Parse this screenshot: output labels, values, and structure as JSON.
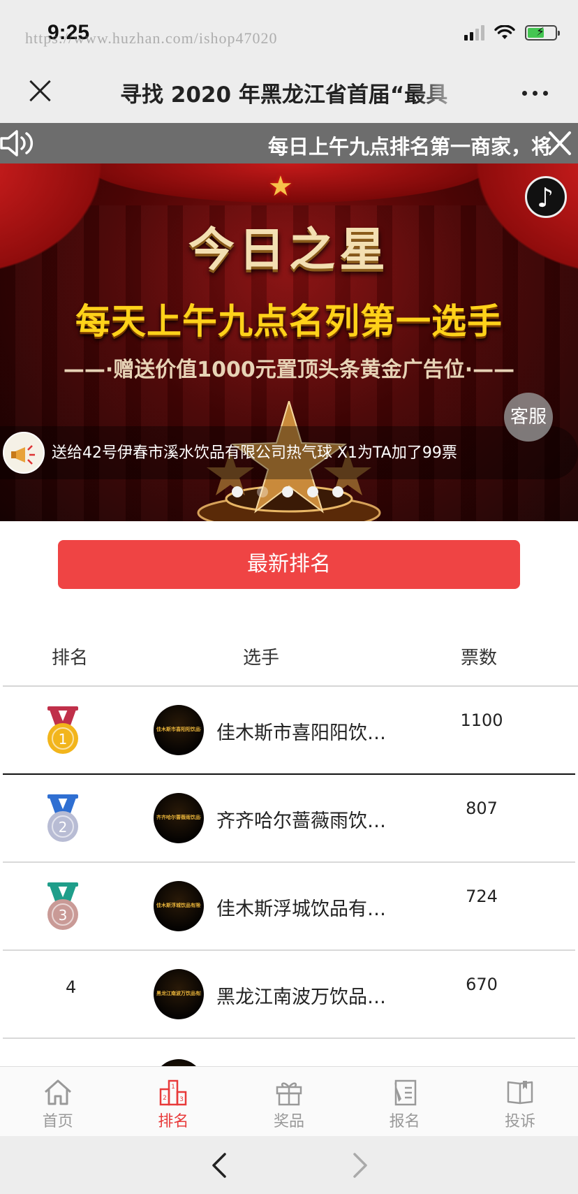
{
  "status_bar": {
    "time": "9:25",
    "watermark": "https://www.huzhan.com/ishop47020",
    "battery_level": 0.6
  },
  "nav": {
    "title": "寻找 2020 年黑龙江省首届“最具"
  },
  "marquee": {
    "text": "每日上午九点排名第一商家，将"
  },
  "banner": {
    "headline": "今日之星",
    "subline": "每天上午九点名列第一选手",
    "promo": "——·赠送价值1000元置顶头条黄金广告位·——",
    "gift_message": "送给42号伊春市溪水饮品有限公司热气球 X1为TA加了99票",
    "service_label": "客服",
    "slide_count": 5,
    "active_slide": 0
  },
  "latest_button": "最新排名",
  "table": {
    "headers": {
      "rank": "排名",
      "player": "选手",
      "votes": "票数"
    },
    "rows": [
      {
        "rank": "1",
        "medal_color": "#f2b51b",
        "ribbon_color": "#c0304a",
        "name": "佳木斯市喜阳阳饮…",
        "avatar_label": "佳木斯市喜阳阳饮品有限公司",
        "votes": "1100"
      },
      {
        "rank": "2",
        "medal_color": "#b8bcd4",
        "ribbon_color": "#2f6fd2",
        "name": "齐齐哈尔蔷薇雨饮…",
        "avatar_label": "齐齐哈尔蔷薇雨饮品有限公司",
        "votes": "807"
      },
      {
        "rank": "3",
        "medal_color": "#c99a96",
        "ribbon_color": "#1f9e8a",
        "name": "佳木斯浮城饮品有…",
        "avatar_label": "佳木斯浮城饮品有限公司",
        "votes": "724"
      },
      {
        "rank": "4",
        "name": "黑龙江南波万饮品…",
        "avatar_label": "黑龙江南波万饮品有限公司",
        "votes": "670"
      }
    ]
  },
  "tabs": [
    {
      "label": "首页",
      "icon": "home-icon"
    },
    {
      "label": "排名",
      "icon": "podium-icon",
      "active": true
    },
    {
      "label": "奖品",
      "icon": "gift-icon"
    },
    {
      "label": "报名",
      "icon": "signup-icon"
    },
    {
      "label": "投诉",
      "icon": "book-icon"
    }
  ],
  "colors": {
    "accent": "#ef4444",
    "active_tab": "#e83a3a",
    "inactive_tab": "#999999"
  }
}
